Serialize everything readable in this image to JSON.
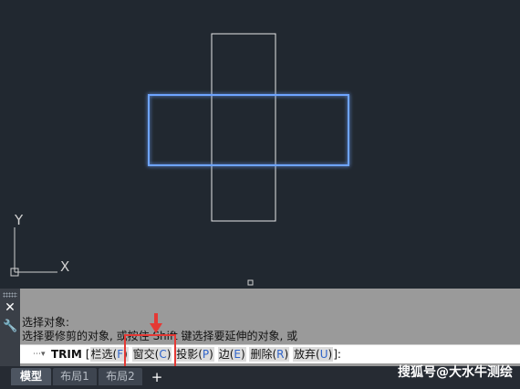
{
  "drawing": {
    "ucs_y_label": "Y",
    "ucs_x_label": "X",
    "colors": {
      "background": "#212830",
      "vertical_rect": "#e8e8e8",
      "horizontal_rect": "#6ea4ff"
    }
  },
  "command_panel": {
    "close_icon": "close-icon",
    "settings_icon": "wrench-icon",
    "history": [
      "选择对象:",
      "选择要修剪的对象, 或按住 Shift 键选择要延伸的对象, 或"
    ],
    "prompt": {
      "command": "TRIM",
      "open_bracket": "[",
      "options": [
        {
          "label": "栏选(",
          "key": "F",
          "close": ")"
        },
        {
          "label": "窗交(",
          "key": "C",
          "close": ")"
        },
        {
          "label": "投影(",
          "key": "P",
          "close": ")"
        },
        {
          "label": "边(",
          "key": "E",
          "close": ")"
        },
        {
          "label": "删除(",
          "key": "R",
          "close": ")"
        },
        {
          "label": "放弃(",
          "key": "U",
          "close": ")"
        }
      ],
      "end": "]:"
    },
    "annotation_color": "#e53935"
  },
  "tabs": [
    {
      "label": "模型",
      "active": true
    },
    {
      "label": "布局1",
      "active": false
    },
    {
      "label": "布局2",
      "active": false
    }
  ],
  "tab_add_label": "+",
  "watermark": "搜狐号@大水牛测绘"
}
